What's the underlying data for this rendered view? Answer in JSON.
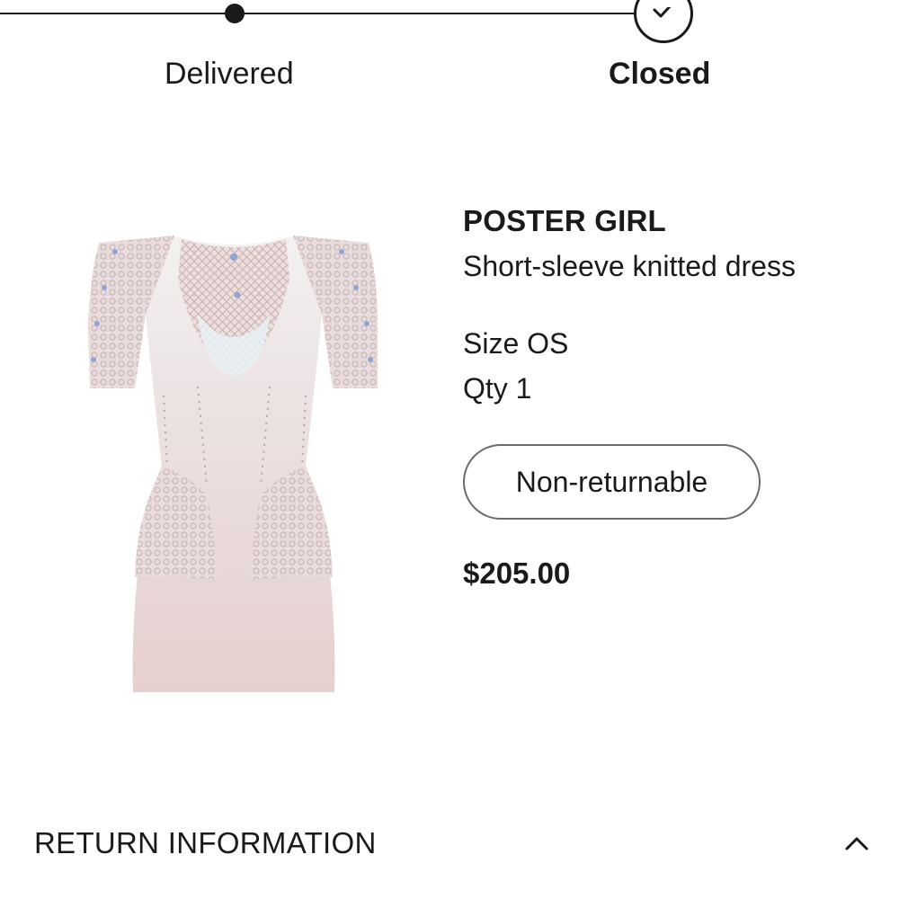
{
  "tracker": {
    "steps": [
      {
        "label": "Delivered",
        "state": "complete"
      },
      {
        "label": "Closed",
        "state": "current"
      }
    ]
  },
  "product": {
    "brand": "POSTER GIRL",
    "description": "Short-sleeve knitted dress",
    "size_text": "Size OS",
    "qty_text": "Qty 1",
    "badge": "Non-returnable",
    "price": "$205.00"
  },
  "return_info": {
    "label": "RETURN INFORMATION",
    "icon": "chevron-up-icon",
    "expanded": true
  },
  "colors": {
    "text": "#1a1a1a",
    "badge_border": "#6b6b6b",
    "dress_pink": "#e8d3d3"
  }
}
